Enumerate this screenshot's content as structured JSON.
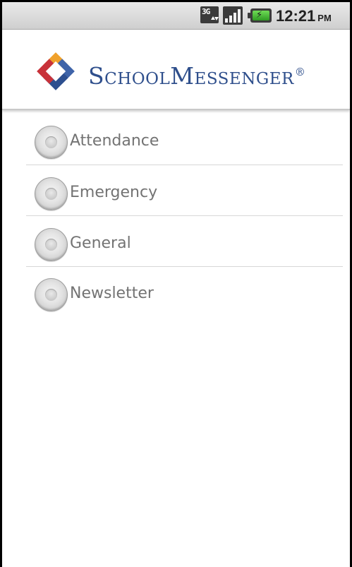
{
  "status_bar": {
    "network_label": "3G",
    "time": "12:21",
    "ampm": "PM"
  },
  "header": {
    "logo_text": "SchoolMessenger",
    "registered_mark": "®"
  },
  "categories": [
    {
      "label": "Attendance",
      "selected": false
    },
    {
      "label": "Emergency",
      "selected": false
    },
    {
      "label": "General",
      "selected": false
    },
    {
      "label": "Newsletter",
      "selected": false
    }
  ],
  "icons": {
    "network": "3g-data-icon",
    "signal": "signal-strength-icon",
    "battery": "battery-charging-icon",
    "logo": "schoolmessenger-logo-icon",
    "radio": "radio-button-icon"
  },
  "colors": {
    "brand_text": "#2f4f8c",
    "logo_red": "#c8323a",
    "logo_orange": "#f0a12b",
    "logo_blue": "#3f64a9",
    "label_gray": "#737373",
    "battery_green": "#4fbd3a"
  }
}
